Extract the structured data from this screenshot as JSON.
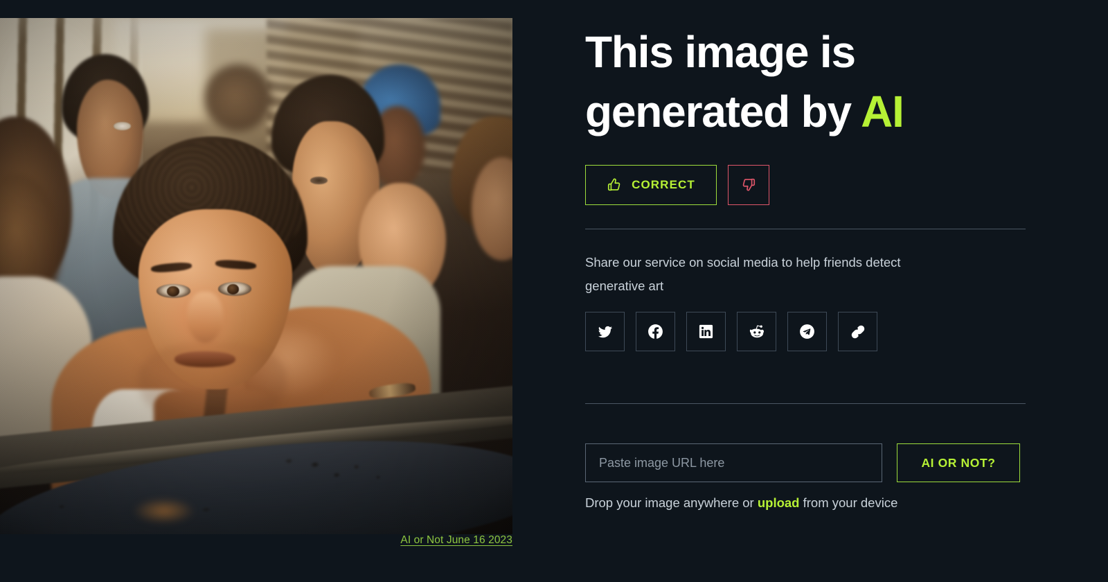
{
  "theme": {
    "background": "#0e151c",
    "accent_green": "#b6f135",
    "accent_green_border": "#9ede3c",
    "accent_red": "#e0566a",
    "text_primary": "#ffffff",
    "text_secondary": "#c9d2da",
    "divider": "#5b6775",
    "caption_green": "#8ec640"
  },
  "result": {
    "headline_line1": "This image is",
    "headline_line2_prefix": "generated by ",
    "headline_accent": "AI"
  },
  "feedback": {
    "correct_label": "CORRECT",
    "correct_icon": "thumbs-up-icon",
    "wrong_icon": "thumbs-down-icon"
  },
  "share": {
    "description": "Share our service on social media to help friends detect generative art",
    "buttons": [
      {
        "name": "twitter",
        "icon": "twitter-icon"
      },
      {
        "name": "facebook",
        "icon": "facebook-icon"
      },
      {
        "name": "linkedin",
        "icon": "linkedin-icon"
      },
      {
        "name": "reddit",
        "icon": "reddit-icon"
      },
      {
        "name": "telegram",
        "icon": "telegram-icon"
      },
      {
        "name": "copy-link",
        "icon": "link-icon"
      }
    ]
  },
  "upload": {
    "url_placeholder": "Paste image URL here",
    "url_value": "",
    "submit_label": "AI OR NOT?",
    "drop_prefix": "Drop your image anywhere or ",
    "drop_link": "upload",
    "drop_suffix": " from your device"
  },
  "image": {
    "caption": "AI or Not June 16 2023",
    "alt": "Crowd of young men seated closely together in warm indoor light, resting on a wooden bench rail"
  }
}
